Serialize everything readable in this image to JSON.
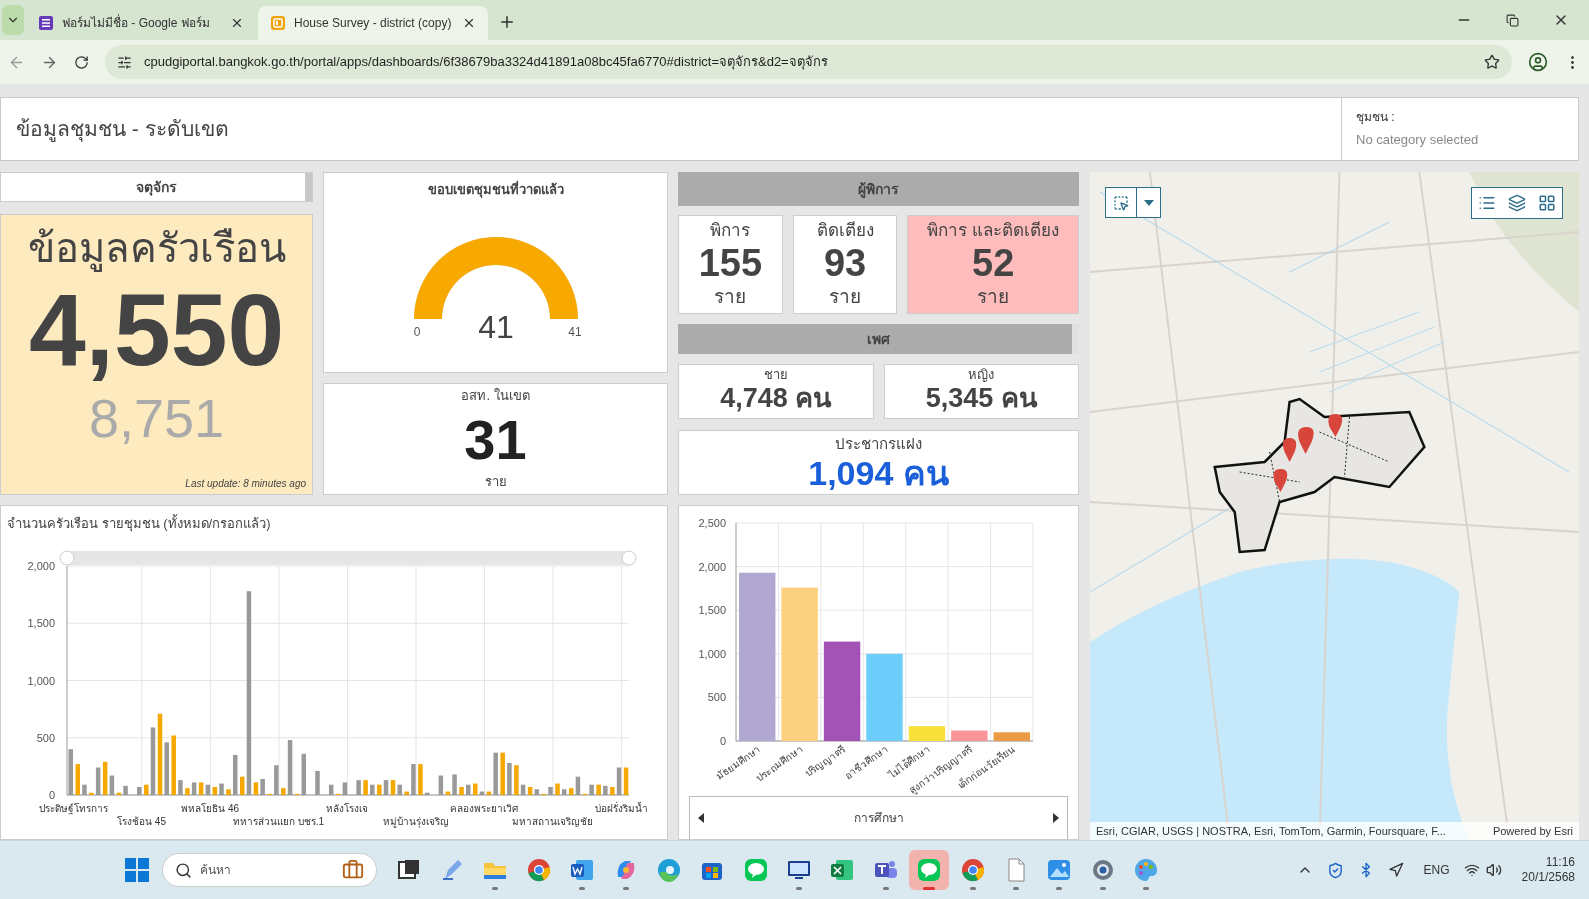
{
  "browser": {
    "tabs": [
      {
        "title": "ฟอร์มไม่มีชื่อ - Google ฟอร์ม",
        "kind": "forms",
        "selected": false
      },
      {
        "title": "House Survey - district (copy)",
        "kind": "dashboard",
        "selected": true
      }
    ],
    "url": "cpudgiportal.bangkok.go.th/portal/apps/dashboards/6f38679ba3324d41891a08bc45fa6770#district=จตุจักร&d2=จตุจักร"
  },
  "header": {
    "title": "ข้อมูลชุมชน - ระดับเขต",
    "filter": {
      "label": "ชุมชน :",
      "placeholder": "No category selected"
    }
  },
  "district": {
    "title": "จตุจักร"
  },
  "household": {
    "title": "ข้อมูลครัวเรือน",
    "value": "4,550",
    "secondary": "8,751",
    "last_update": "Last update: 8 minutes ago"
  },
  "boundary_gauge": {
    "title": "ขอบเขตชุมชนที่วาดแล้ว",
    "value": "41",
    "min": "0",
    "max": "41",
    "level": 1
  },
  "volunteers": {
    "title": "อสท. ในเขต",
    "value": "31",
    "unit": "ราย"
  },
  "disabled_section": {
    "title": "ผู้พิการ",
    "cards": [
      {
        "label": "พิการ",
        "value": "155",
        "unit": "ราย",
        "highlight": false
      },
      {
        "label": "ติดเตียง",
        "value": "93",
        "unit": "ราย",
        "highlight": false
      },
      {
        "label": "พิการ และติดเตียง",
        "value": "52",
        "unit": "ราย",
        "highlight": true
      }
    ]
  },
  "gender": {
    "title": "เพศ",
    "cards": [
      {
        "label": "ชาย",
        "value": "4,748 คน"
      },
      {
        "label": "หญิง",
        "value": "5,345 คน"
      }
    ]
  },
  "hidden_population": {
    "label": "ประชากรแฝง",
    "value": "1,094 คน"
  },
  "household_chart": {
    "title": "จำนวนครัวเรือน รายชุมชน (ทั้งหมด/กรอกแล้ว)",
    "chart_data": {
      "type": "bar",
      "grid": true,
      "ylim": [
        0,
        2000
      ],
      "yticks": [
        0,
        {
          "value": 500,
          "label": "500"
        },
        {
          "value": 1000,
          "label": "1,000"
        },
        {
          "value": 1500,
          "label": "1,500"
        },
        {
          "value": 2000,
          "label": "2,000"
        }
      ],
      "categories": [
        "ประดิษฐ์โทรการ",
        null,
        null,
        null,
        null,
        "โรงช้อน 45",
        null,
        null,
        null,
        null,
        "พหลโยธิน 46",
        null,
        null,
        null,
        null,
        "ทหารส่วนแยก บชร.1",
        null,
        null,
        null,
        null,
        "หลังโรงเจ",
        null,
        null,
        null,
        null,
        "หมู่บ้านรุ่งเจริญ",
        null,
        null,
        null,
        null,
        "คลองพระยาเวิศ",
        null,
        null,
        null,
        null,
        "มหาสถานเจริญชัย",
        null,
        null,
        null,
        null,
        "บ่อฝรั่งริมน้ำ"
      ],
      "series": [
        {
          "color": "#999999",
          "values": [
            400,
            90,
            240,
            170,
            80,
            70,
            590,
            460,
            130,
            110,
            90,
            100,
            350,
            1780,
            140,
            260,
            480,
            360,
            210,
            90,
            110,
            130,
            90,
            130,
            90,
            270,
            20,
            170,
            180,
            90,
            30,
            370,
            280,
            90,
            50,
            70,
            50,
            160,
            90,
            80,
            240
          ]
        },
        {
          "color": "#f5a800",
          "values": [
            270,
            20,
            290,
            20,
            0,
            90,
            710,
            520,
            60,
            110,
            70,
            50,
            160,
            110,
            10,
            60,
            10,
            0,
            0,
            10,
            0,
            130,
            90,
            130,
            30,
            270,
            0,
            30,
            70,
            100,
            30,
            370,
            260,
            70,
            10,
            100,
            60,
            10,
            90,
            70,
            240
          ]
        }
      ]
    }
  },
  "education_chart": {
    "chart_data": {
      "type": "bar",
      "grid": true,
      "xlabel": "การศึกษา",
      "ylim": [
        0,
        2500
      ],
      "yticks": [
        0,
        {
          "value": 500,
          "label": "500"
        },
        {
          "value": 1000,
          "label": "1,000"
        },
        {
          "value": 1500,
          "label": "1,500"
        },
        {
          "value": 2000,
          "label": "2,000"
        },
        {
          "value": 2500,
          "label": "2,500"
        }
      ],
      "categories": [
        "มัธยมศึกษา",
        "ประถมศึกษา",
        "ปริญญาตรี",
        "อาชีวศึกษา",
        "ไม่ได้ศึกษา",
        "สูงกว่าปริญญาตรี",
        "เด็กก่อนวัยเรียน"
      ],
      "values": [
        1930,
        1760,
        1140,
        1000,
        170,
        120,
        100
      ],
      "colors": [
        "#b0a8d0",
        "#fbd07e",
        "#a352b5",
        "#6dcdfa",
        "#f8e03a",
        "#f99498",
        "#ec9b45"
      ]
    }
  },
  "map": {
    "attribution": "Esri, CGIAR, USGS | NOSTRA, Esri, TomTom, Garmin, Foursquare, F...",
    "credit": "Powered by Esri"
  },
  "taskbar": {
    "search_placeholder": "ค้นหา",
    "apps": [
      {
        "kind": "taskview",
        "running": false,
        "selected": false
      },
      {
        "kind": "pen",
        "running": false,
        "selected": false
      },
      {
        "kind": "folder",
        "running": true,
        "selected": false
      },
      {
        "kind": "chrome",
        "running": false,
        "selected": false
      },
      {
        "kind": "word",
        "running": true,
        "selected": false
      },
      {
        "kind": "copilot",
        "running": true,
        "selected": false
      },
      {
        "kind": "edge",
        "running": false,
        "selected": false
      },
      {
        "kind": "store",
        "running": false,
        "selected": false
      },
      {
        "kind": "chat",
        "running": false,
        "selected": false
      },
      {
        "kind": "remote",
        "running": true,
        "selected": false
      },
      {
        "kind": "excel",
        "running": false,
        "selected": false
      },
      {
        "kind": "teams",
        "running": true,
        "selected": false
      },
      {
        "kind": "chat",
        "running": true,
        "selected": true
      },
      {
        "kind": "chrome",
        "running": true,
        "selected": false
      },
      {
        "kind": "file",
        "running": true,
        "selected": false
      },
      {
        "kind": "photos",
        "running": true,
        "selected": false
      },
      {
        "kind": "settings",
        "running": true,
        "selected": false
      },
      {
        "kind": "paint",
        "running": true,
        "selected": false
      }
    ],
    "language": "ENG",
    "time": "11:16",
    "date": "20/1/2568"
  }
}
